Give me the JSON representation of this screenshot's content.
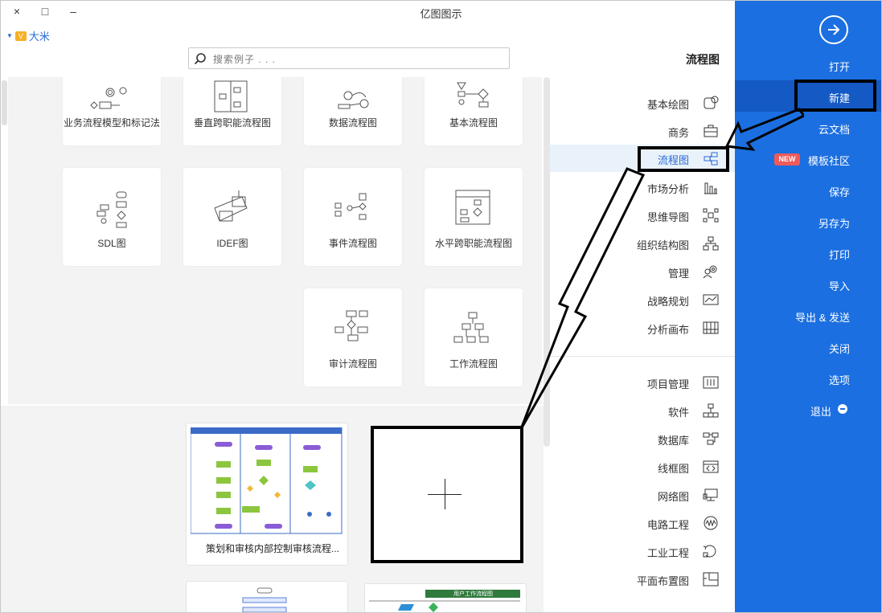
{
  "window": {
    "title": "亿图图示",
    "close_glyph": "×",
    "maximize_glyph": "□",
    "minimize_glyph": "–"
  },
  "user": {
    "name": "大米"
  },
  "search": {
    "placeholder": "搜索例子 . . ."
  },
  "category_title": "流程图",
  "templates": [
    {
      "label": "基本流程图",
      "icon": "basic-flowchart-icon"
    },
    {
      "label": "数据流程图",
      "icon": "data-flow-icon"
    },
    {
      "label": "垂直跨职能流程图",
      "icon": "vertical-crossfunctional-icon"
    },
    {
      "label": "业务流程模型和标记法",
      "icon": "bpmn-icon"
    },
    {
      "label": "水平跨职能流程图",
      "icon": "horizontal-crossfunctional-icon"
    },
    {
      "label": "事件流程图",
      "icon": "event-flow-icon"
    },
    {
      "label": "IDEF图",
      "icon": "idef-icon"
    },
    {
      "label": "SDL图",
      "icon": "sdl-icon"
    },
    {
      "label": "工作流程图",
      "icon": "workflow-icon"
    },
    {
      "label": "审计流程图",
      "icon": "audit-flow-icon"
    }
  ],
  "examples": [
    {
      "title": "策划和审核内部控制审核流程..."
    },
    {
      "title": "",
      "thumb_header": "用户工作流程图"
    }
  ],
  "categories_group1": [
    {
      "label": "基本绘图",
      "icon": "basic-drawing-icon"
    },
    {
      "label": "商务",
      "icon": "briefcase-icon"
    },
    {
      "label": "流程图",
      "icon": "flowchart-icon",
      "active": true
    },
    {
      "label": "市场分析",
      "icon": "bar-chart-icon"
    },
    {
      "label": "思维导图",
      "icon": "mindmap-icon"
    },
    {
      "label": "组织结构图",
      "icon": "org-chart-icon"
    },
    {
      "label": "管理",
      "icon": "gear-person-icon"
    },
    {
      "label": "战略规划",
      "icon": "strategy-icon"
    },
    {
      "label": "分析画布",
      "icon": "canvas-icon"
    }
  ],
  "categories_group2": [
    {
      "label": "项目管理",
      "icon": "project-icon"
    },
    {
      "label": "软件",
      "icon": "software-icon"
    },
    {
      "label": "数据库",
      "icon": "database-icon"
    },
    {
      "label": "线框图",
      "icon": "wireframe-icon"
    },
    {
      "label": "网络图",
      "icon": "network-icon"
    },
    {
      "label": "电路工程",
      "icon": "circuit-icon"
    },
    {
      "label": "工业工程",
      "icon": "industrial-icon"
    },
    {
      "label": "平面布置图",
      "icon": "floorplan-icon"
    }
  ],
  "sidebar": {
    "items": [
      {
        "label": "打开"
      },
      {
        "label": "新建",
        "active": true
      },
      {
        "label": "云文档"
      },
      {
        "label": "模板社区",
        "badge": "NEW"
      },
      {
        "label": "保存"
      },
      {
        "label": "另存为"
      },
      {
        "label": "打印"
      },
      {
        "label": "导入"
      },
      {
        "label": "导出 & 发送"
      },
      {
        "label": "关闭"
      },
      {
        "label": "选项"
      },
      {
        "label": "退出",
        "icon": "exit-icon"
      }
    ]
  },
  "colors": {
    "sidebar_bg": "#1b6fe1",
    "sidebar_active": "#1459c4",
    "accent": "#2a6bd6",
    "new_badge": "#f05a5a"
  }
}
